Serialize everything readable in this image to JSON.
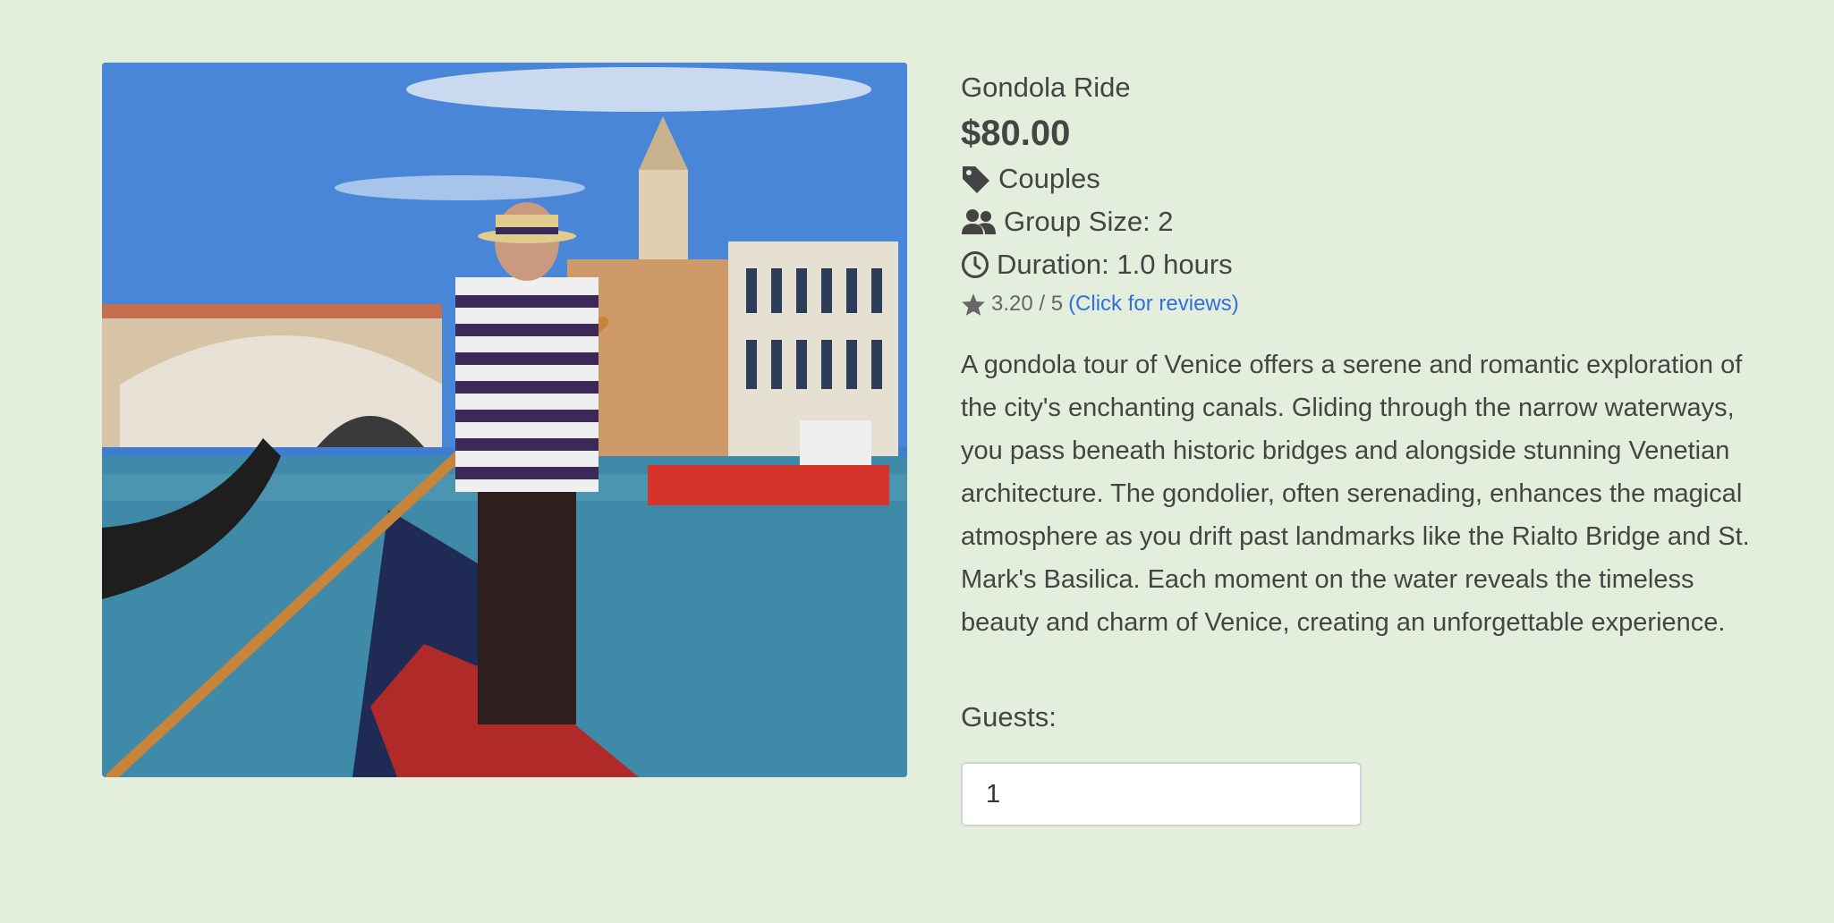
{
  "tour": {
    "title": "Gondola Ride",
    "price": "$80.00",
    "category": "Couples",
    "group_size": "Group Size: 2",
    "duration": "Duration: 1.0 hours",
    "rating": "3.20 / 5",
    "reviews_link": "(Click for reviews)",
    "description": "A gondola tour of Venice offers a serene and romantic exploration of the city's enchanting canals. Gliding through the narrow waterways, you pass beneath historic bridges and alongside stunning Venetian architecture. The gondolier, often serenading, enhances the magical atmosphere as you drift past landmarks like the Rialto Bridge and St. Mark's Basilica. Each moment on the water reveals the timeless beauty and charm of Venice, creating an unforgettable experience."
  },
  "booking": {
    "guests_label": "Guests:",
    "guests_value": "1"
  },
  "icons": {
    "category": "tag-icon",
    "group": "users-icon",
    "duration": "clock-icon",
    "rating": "star-icon"
  },
  "colors": {
    "background": "#e3efdc",
    "link": "#2f6fe4",
    "text": "#444444"
  }
}
